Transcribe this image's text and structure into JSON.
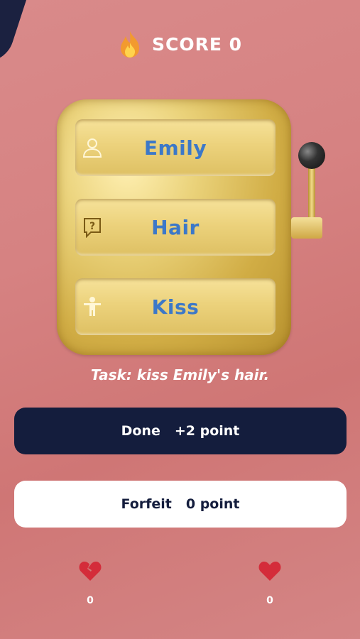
{
  "score": {
    "label": "SCORE 0",
    "value": 0
  },
  "reels": [
    {
      "icon": "person-icon",
      "label": "Emily"
    },
    {
      "icon": "question-icon",
      "label": "Hair"
    },
    {
      "icon": "action-figure-icon",
      "label": "Kiss"
    }
  ],
  "task": "Task: kiss Emily's hair.",
  "buttons": {
    "done": {
      "action": "Done",
      "points": "+2 point"
    },
    "forfeit": {
      "action": "Forfeit",
      "points": "0 point"
    }
  },
  "stats": {
    "broken_hearts": "0",
    "hearts": "0"
  },
  "colors": {
    "background": "#d68282",
    "reel_text": "#3c78c8",
    "navy": "#141d3d",
    "gold": "#e1c266"
  }
}
